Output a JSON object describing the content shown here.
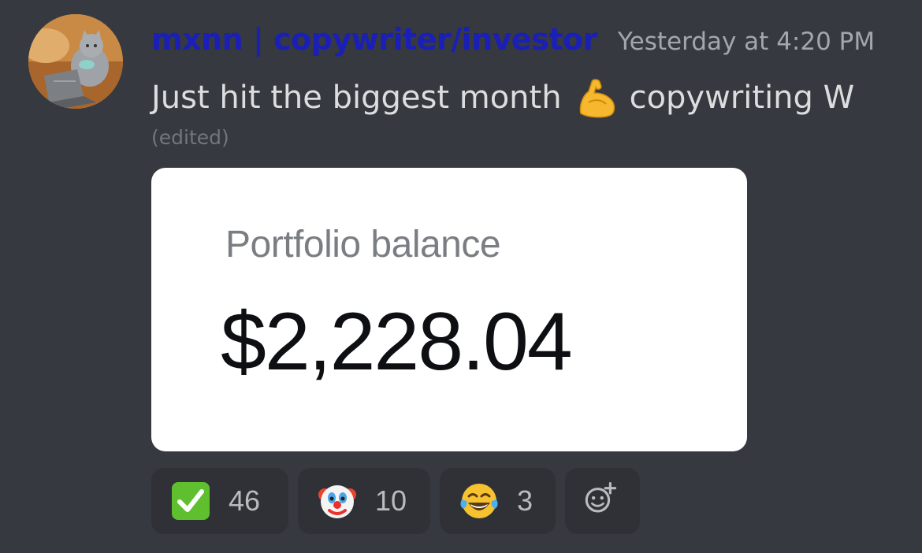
{
  "message": {
    "username": "mxnn | copywriter/investor",
    "timestamp": "Yesterday at 4:20 PM",
    "text_before": "Just hit the biggest month",
    "text_after": "copywriting W",
    "inline_emoji": "flexed-biceps-icon",
    "edited_label": "(edited)",
    "avatar": "cat-laptop-avatar"
  },
  "attachment": {
    "label": "Portfolio balance",
    "value": "$2,228.04"
  },
  "reactions": [
    {
      "icon": "check-mark-button-icon",
      "count": "46"
    },
    {
      "icon": "clown-face-icon",
      "count": "10"
    },
    {
      "icon": "tears-of-joy-icon",
      "count": "3"
    }
  ],
  "add_reaction_icon": "add-reaction-icon",
  "colors": {
    "background": "#36393f",
    "username": "#1a1fb8",
    "timestamp": "#a3a6aa",
    "text": "#dcddde",
    "reaction_bg": "#2f3136"
  }
}
